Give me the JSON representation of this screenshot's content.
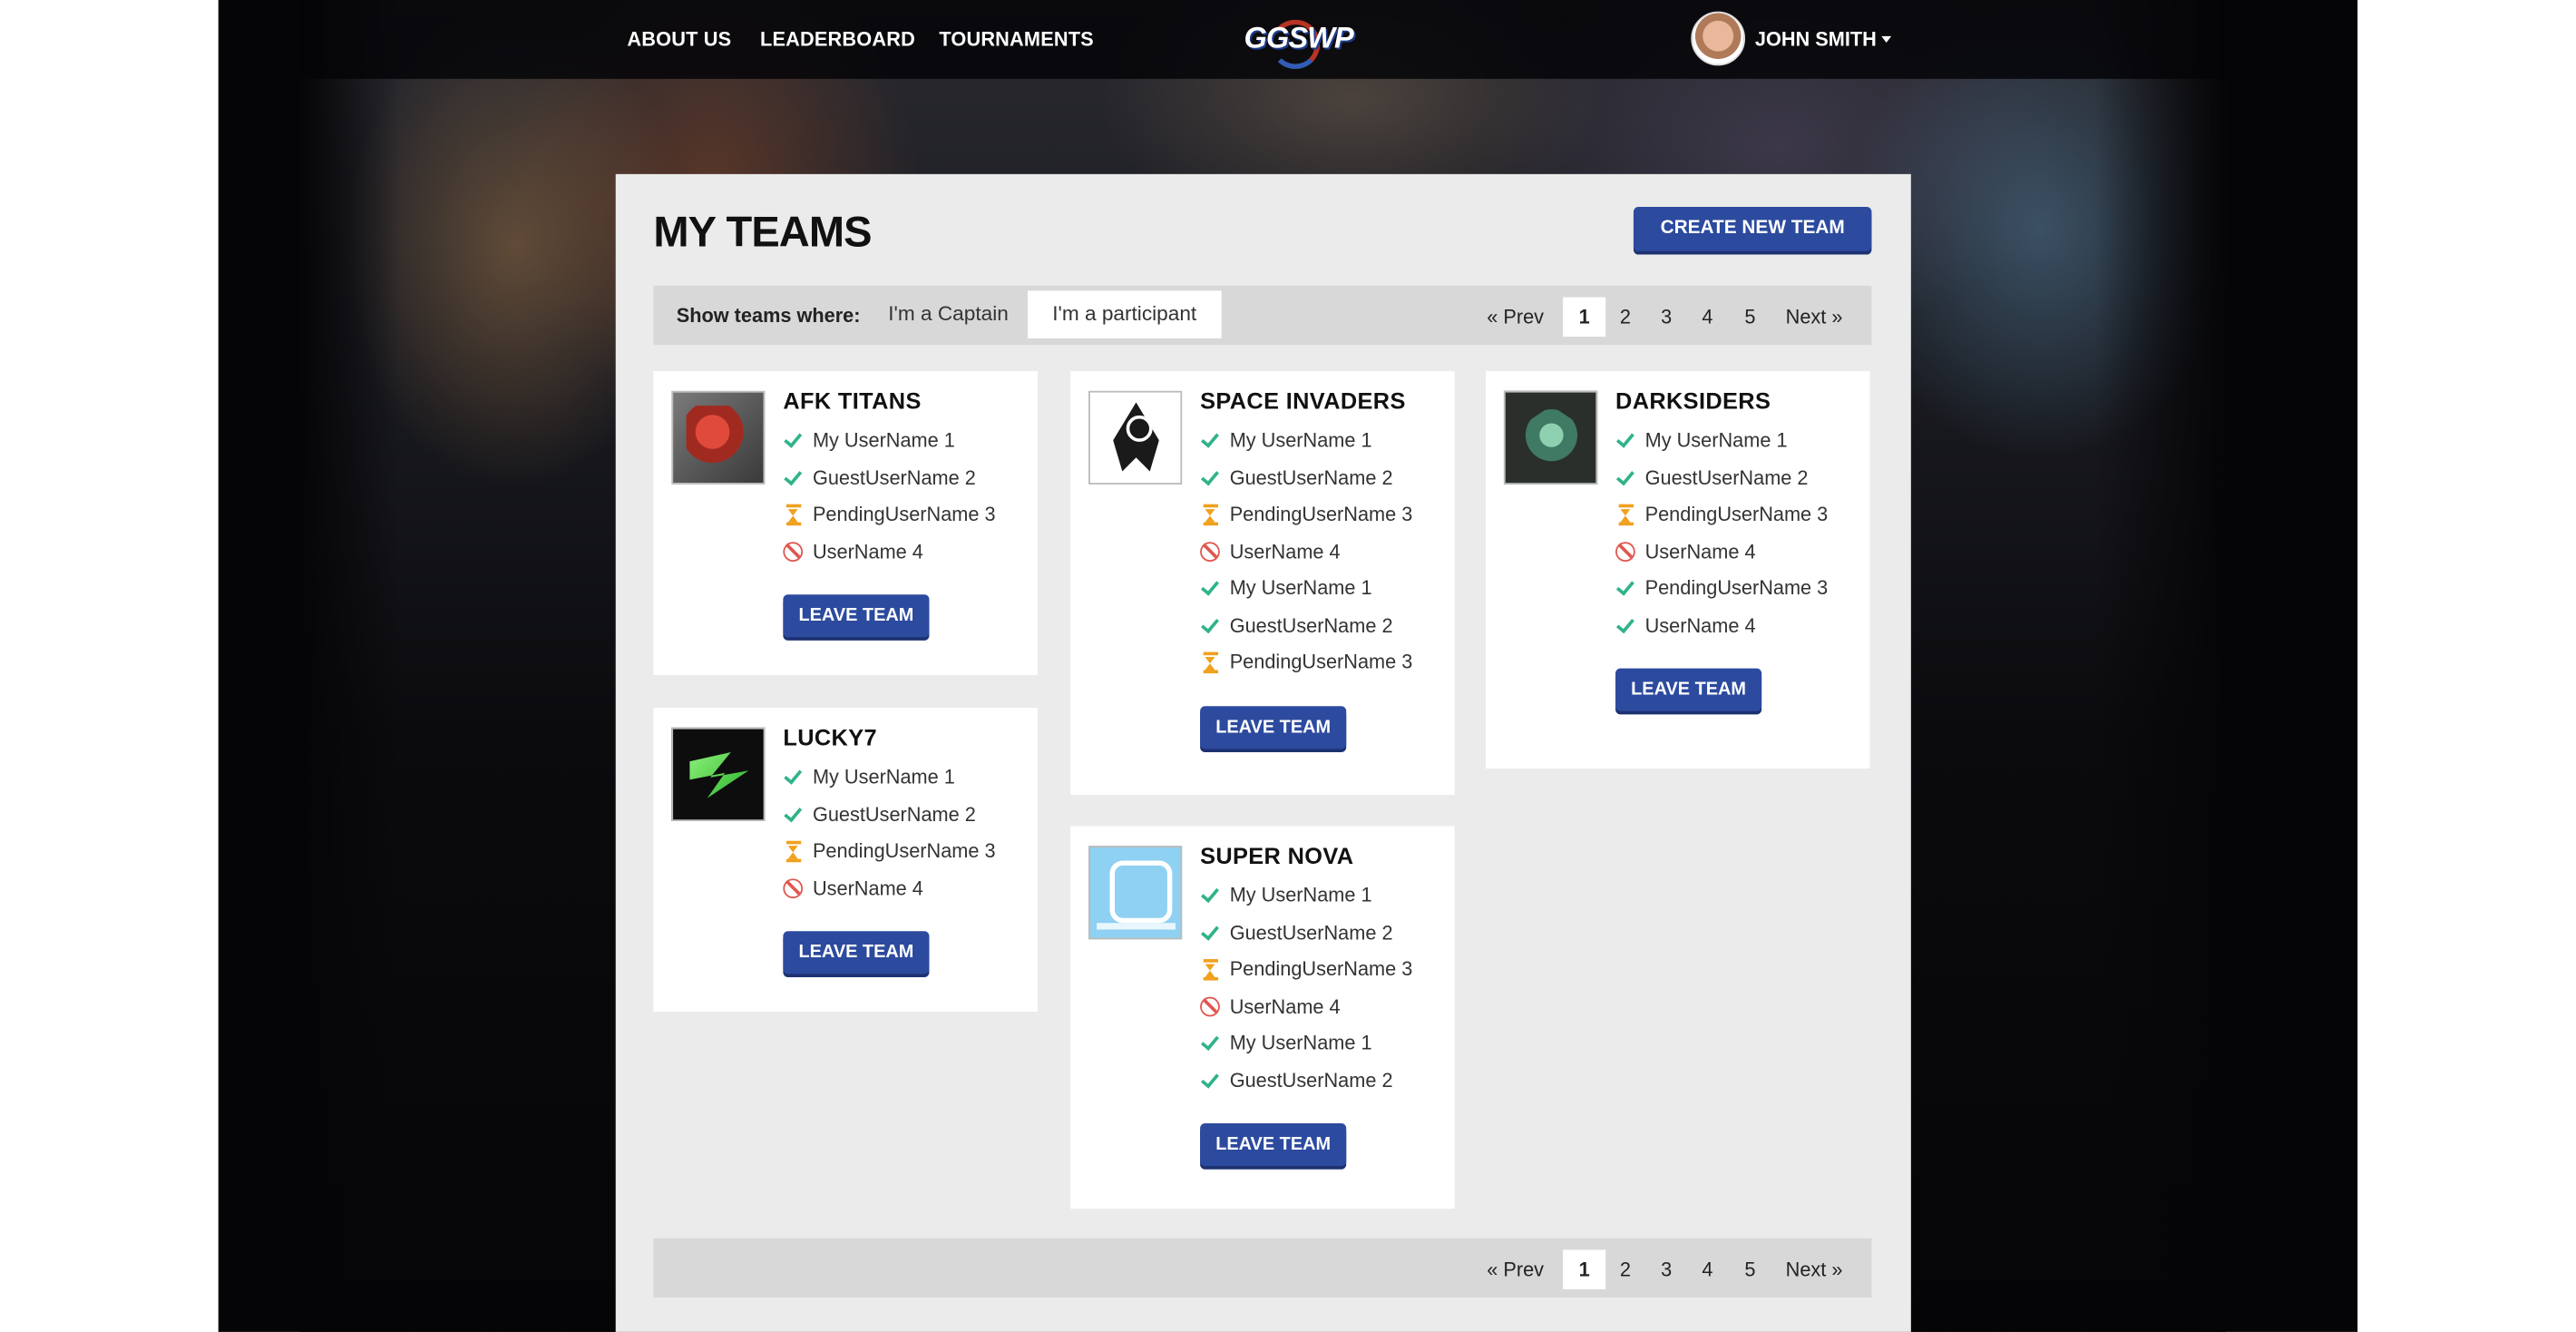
{
  "nav": {
    "links": [
      "ABOUT US",
      "LEADERBOARD",
      "TOURNAMENTS"
    ],
    "logo_text": "GGSWP",
    "user_name": "JOHN SMITH"
  },
  "page": {
    "title": "MY TEAMS",
    "create_button": "CREATE NEW TEAM",
    "filter_label": "Show teams where:",
    "filter_options": [
      "I'm a Captain",
      "I'm a participant"
    ],
    "active_filter": "I'm a participant",
    "pagination": [
      "« Prev",
      "1",
      "2",
      "3",
      "4",
      "5",
      "Next »"
    ],
    "current_page": "1"
  },
  "teams": [
    {
      "name": "AFK TITANS",
      "logo": "afk-titans-logo",
      "members": [
        {
          "name": "My UserName 1",
          "status": "confirmed"
        },
        {
          "name": "GuestUserName 2",
          "status": "confirmed"
        },
        {
          "name": "PendingUserName 3",
          "status": "pending"
        },
        {
          "name": "UserName 4",
          "status": "declined"
        }
      ],
      "leave_label": "LEAVE TEAM"
    },
    {
      "name": "SPACE INVADERS",
      "logo": "space-invaders-logo",
      "members": [
        {
          "name": "My UserName 1",
          "status": "confirmed"
        },
        {
          "name": "GuestUserName 2",
          "status": "confirmed"
        },
        {
          "name": "PendingUserName 3",
          "status": "pending"
        },
        {
          "name": "UserName 4",
          "status": "declined"
        },
        {
          "name": "My UserName 1",
          "status": "confirmed"
        },
        {
          "name": "GuestUserName 2",
          "status": "confirmed"
        },
        {
          "name": "PendingUserName 3",
          "status": "pending"
        }
      ],
      "leave_label": "LEAVE TEAM"
    },
    {
      "name": "DARKSIDERS",
      "logo": "darksiders-logo",
      "members": [
        {
          "name": "My UserName 1",
          "status": "confirmed"
        },
        {
          "name": "GuestUserName 2",
          "status": "confirmed"
        },
        {
          "name": "PendingUserName 3",
          "status": "pending"
        },
        {
          "name": "UserName 4",
          "status": "declined"
        },
        {
          "name": "PendingUserName 3",
          "status": "confirmed"
        },
        {
          "name": "UserName 4",
          "status": "confirmed"
        }
      ],
      "leave_label": "LEAVE TEAM"
    },
    {
      "name": "LUCKY7",
      "logo": "lucky7-logo",
      "members": [
        {
          "name": "My UserName 1",
          "status": "confirmed"
        },
        {
          "name": "GuestUserName 2",
          "status": "confirmed"
        },
        {
          "name": "PendingUserName 3",
          "status": "pending"
        },
        {
          "name": "UserName 4",
          "status": "declined"
        }
      ],
      "leave_label": "LEAVE TEAM"
    },
    {
      "name": "SUPER NOVA",
      "logo": "super-nova-logo",
      "members": [
        {
          "name": "My UserName 1",
          "status": "confirmed"
        },
        {
          "name": "GuestUserName 2",
          "status": "confirmed"
        },
        {
          "name": "PendingUserName 3",
          "status": "pending"
        },
        {
          "name": "UserName 4",
          "status": "declined"
        },
        {
          "name": "My UserName 1",
          "status": "confirmed"
        },
        {
          "name": "GuestUserName 2",
          "status": "confirmed"
        }
      ],
      "leave_label": "LEAVE TEAM"
    }
  ],
  "icons": {
    "confirmed": "check-icon",
    "pending": "hourglass-icon",
    "declined": "blocked-icon"
  },
  "colors": {
    "accent": "#2c4a9e",
    "confirmed": "#2fb38a",
    "pending": "#f0a11d",
    "declined": "#e0574f"
  }
}
